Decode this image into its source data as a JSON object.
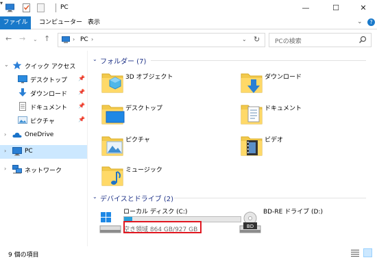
{
  "window": {
    "title": "PC",
    "quick_access_dropdown": "▾",
    "controls": {
      "minimize": "—",
      "maximize": "☐",
      "close": "✕"
    }
  },
  "ribbon": {
    "tabs": [
      "ファイル",
      "コンピューター",
      "表示"
    ],
    "collapse_glyph": "⌄",
    "help_glyph": "?"
  },
  "nav": {
    "back": "←",
    "forward": "→",
    "recent": "⌄",
    "up": "↑",
    "address": {
      "crumb": "PC",
      "sep": "›",
      "dropdown": "⌄",
      "refresh": "↻"
    },
    "search_placeholder": "PCの検索"
  },
  "sidebar": {
    "items": [
      {
        "label": "クイック アクセス",
        "icon": "star-icon",
        "chevron": "⌄"
      },
      {
        "label": "デスクトップ",
        "icon": "desktop-folder-icon",
        "pin": "📌"
      },
      {
        "label": "ダウンロード",
        "icon": "download-arrow-icon",
        "pin": "📌"
      },
      {
        "label": "ドキュメント",
        "icon": "document-icon",
        "pin": "📌"
      },
      {
        "label": "ピクチャ",
        "icon": "pictures-icon",
        "pin": "📌"
      },
      {
        "label": "OneDrive",
        "icon": "cloud-icon",
        "chevron": "›"
      },
      {
        "label": "PC",
        "icon": "computer-icon",
        "chevron": "›",
        "selected": true
      },
      {
        "label": "ネットワーク",
        "icon": "network-icon",
        "chevron": "›"
      }
    ]
  },
  "main": {
    "folders_group": {
      "title": "フォルダー (7)",
      "chevron": "⌄"
    },
    "folders": [
      {
        "label": "3D オブジェクト",
        "icon": "3d-objects-folder-icon"
      },
      {
        "label": "ダウンロード",
        "icon": "downloads-folder-icon"
      },
      {
        "label": "デスクトップ",
        "icon": "desktop-folder-icon"
      },
      {
        "label": "ドキュメント",
        "icon": "documents-folder-icon"
      },
      {
        "label": "ピクチャ",
        "icon": "pictures-folder-icon"
      },
      {
        "label": "ビデオ",
        "icon": "videos-folder-icon"
      },
      {
        "label": "ミュージック",
        "icon": "music-folder-icon"
      }
    ],
    "drives_group": {
      "title": "デバイスとドライブ (2)",
      "chevron": "⌄"
    },
    "drives": [
      {
        "label": "ローカル ディスク (C:)",
        "space": "空き領域 864 GB/927 GB",
        "used_fraction": 0.068,
        "icon": "windows-drive-icon"
      },
      {
        "label": "BD-RE ドライブ (D:)",
        "icon": "bd-drive-icon",
        "badge": "BD"
      }
    ]
  },
  "status": {
    "item_count": "9 個の項目"
  },
  "colors": {
    "accent": "#1979ca",
    "selection": "#cce8ff",
    "highlight": "#e0161f",
    "group_text": "#1e3287",
    "progress": "#26a0da"
  }
}
